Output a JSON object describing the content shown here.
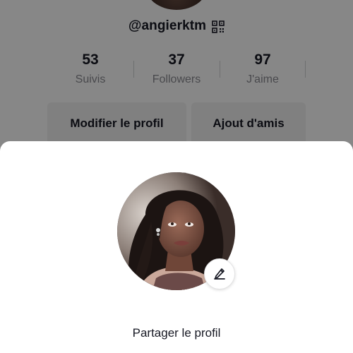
{
  "profile": {
    "username": "@angierktm",
    "stats": [
      {
        "value": "53",
        "label": "Suivis"
      },
      {
        "value": "37",
        "label": "Followers"
      },
      {
        "value": "97",
        "label": "J'aime"
      }
    ],
    "edit_profile_label": "Modifier le profil",
    "add_friends_label": "Ajout d'amis"
  },
  "sheet": {
    "share_label": "Partager le profil"
  },
  "icons": {
    "qr": "qr-code-icon",
    "edit": "pencil-icon"
  }
}
